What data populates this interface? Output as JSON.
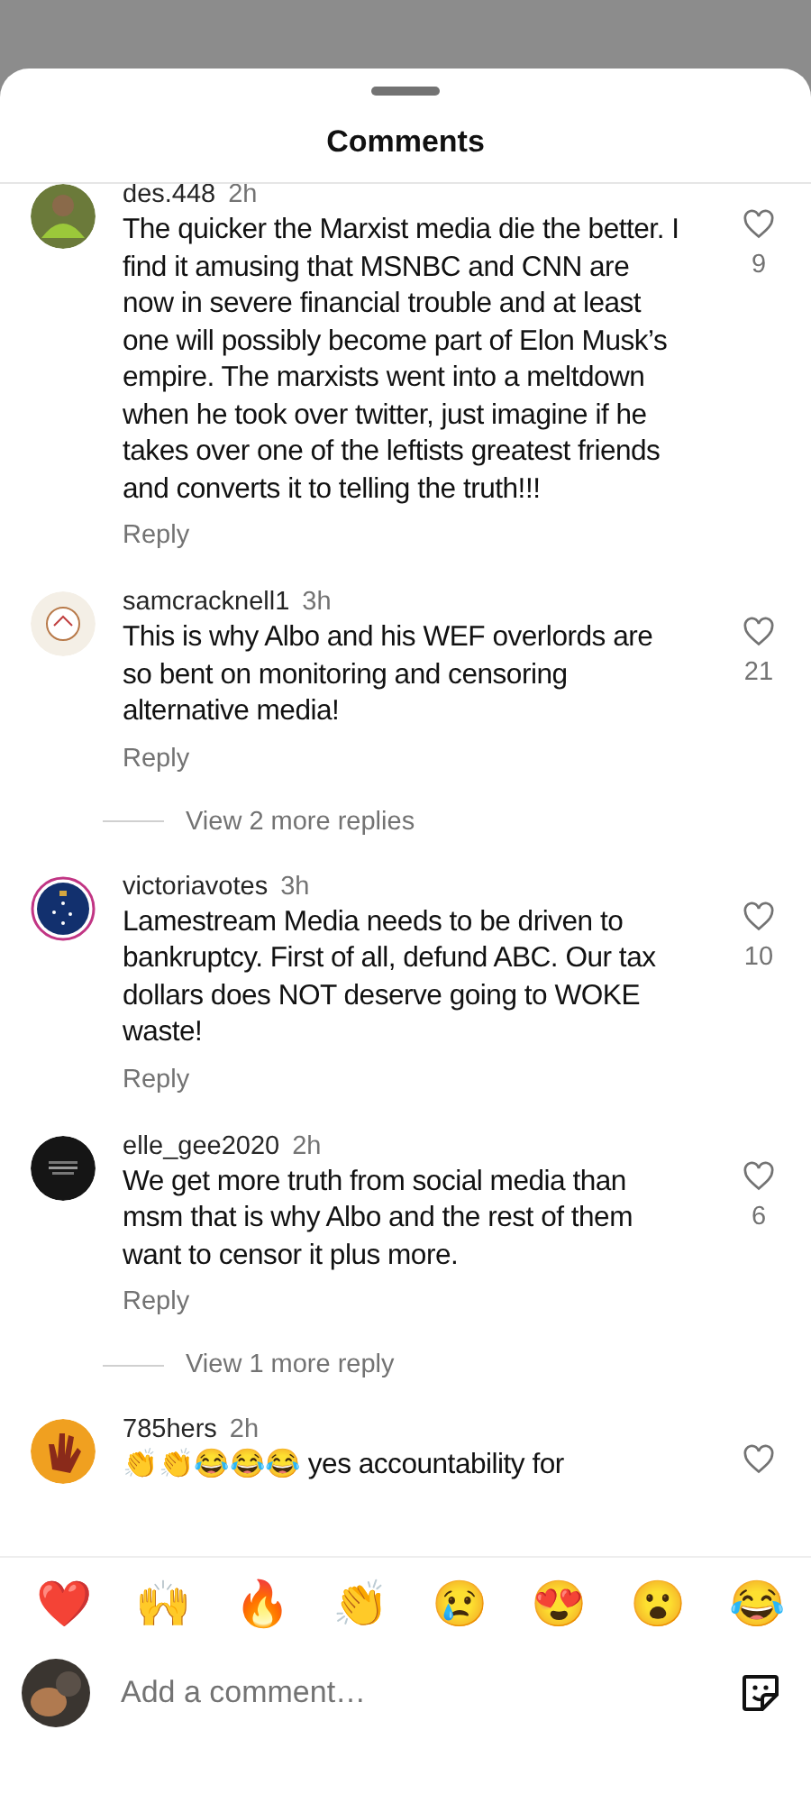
{
  "sheet": {
    "title": "Comments"
  },
  "comments": [
    {
      "username": "des.448",
      "time": "2h",
      "text": "The quicker the Marxist media die the better. I find it amusing that MSNBC and CNN are now in severe financial trouble and at least one will possibly become part of Elon Musk’s empire. The marxists went into a meltdown when he took over twitter, just imagine if he takes over one of the leftists greatest friends and converts it to telling the truth!!!",
      "likes": "9",
      "reply": "Reply"
    },
    {
      "username": "samcracknell1",
      "time": "3h",
      "text": "This is why Albo and his WEF overlords are so bent on monitoring and censoring alternative media!",
      "likes": "21",
      "reply": "Reply",
      "view_replies": "View 2 more replies"
    },
    {
      "username": "victoriavotes",
      "time": "3h",
      "text": "Lamestream Media needs to be driven to bankruptcy. First of all, defund ABC. Our tax dollars does NOT deserve going to WOKE waste!",
      "likes": "10",
      "reply": "Reply",
      "story_ring": true
    },
    {
      "username": "elle_gee2020",
      "time": "2h",
      "text": "We get more truth from social media than msm that is why Albo and the rest of them want to censor it plus more.",
      "likes": "6",
      "reply": "Reply",
      "view_replies": "View 1 more reply"
    },
    {
      "username": "785hers",
      "time": "2h",
      "text": "👏👏😂😂😂 yes accountability for"
    }
  ],
  "reactions": [
    "❤️",
    "🙌",
    "🔥",
    "👏",
    "😢",
    "😍",
    "😮",
    "😂"
  ],
  "composer": {
    "placeholder": "Add a comment…"
  }
}
